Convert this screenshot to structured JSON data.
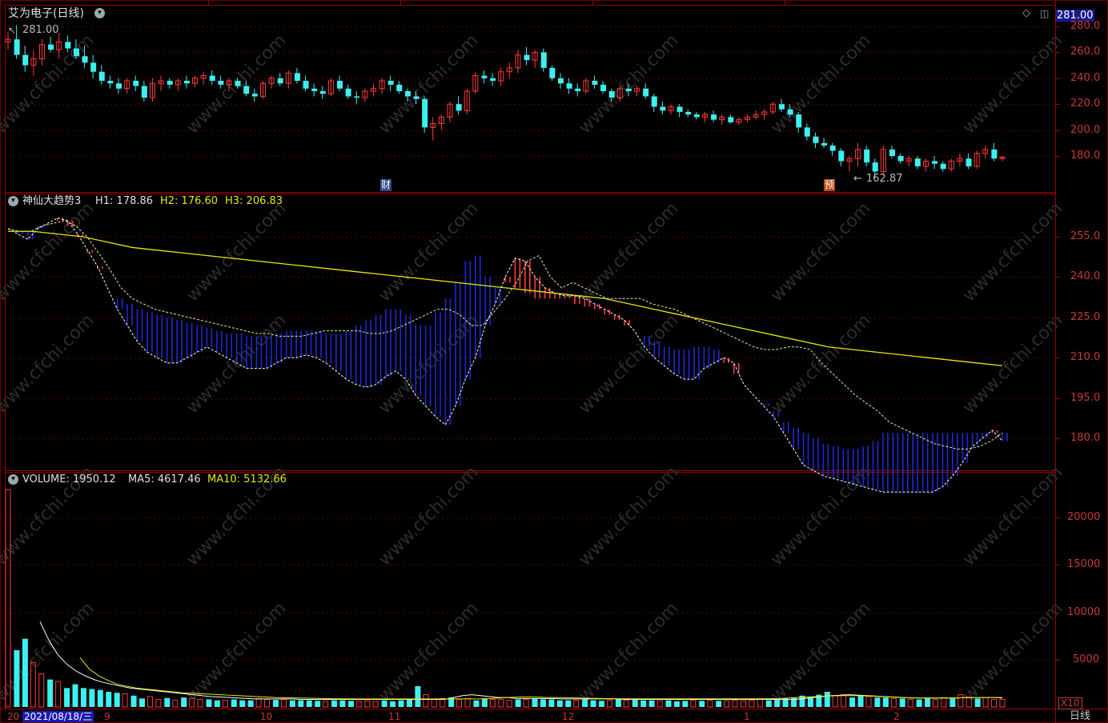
{
  "header": {
    "stock_title": "艾为电子(日线)",
    "price_marker": "281.00",
    "top_value_left": "281.00",
    "low_marker": "162.87",
    "badge_cai": "财",
    "badge_yu": "预"
  },
  "indicator_panel": {
    "name": "神仙大趋势3",
    "h1_label": "H1: 178.86",
    "h2_label": "H2: 176.60",
    "h3_label": "H3: 206.83"
  },
  "volume_panel": {
    "vol_label": "VOLUME: 1950.12",
    "ma5_label": "MA5: 4617.46",
    "ma10_label": "MA10: 5132.66",
    "unit": "X10"
  },
  "price_axis": [
    "280.0",
    "260.0",
    "240.0",
    "220.0",
    "200.0",
    "180.0"
  ],
  "indicator_axis": [
    "255.0",
    "240.0",
    "225.0",
    "210.0",
    "195.0",
    "180.0"
  ],
  "volume_axis": [
    "20000",
    "15000",
    "10000",
    "5000"
  ],
  "time_axis": {
    "cursor_date": "2021/08/18/三",
    "year_prefix": "20",
    "months": [
      "9",
      "10",
      "11",
      "12",
      "1",
      "2"
    ]
  },
  "period": "日线",
  "watermark": "www.cfchi.com",
  "colors": {
    "up": "#ff3a3a",
    "down": "#3cf0f0",
    "grid": "#6a0000",
    "axis": "#c83838",
    "yellow": "#e8e800",
    "white": "#ffffff",
    "blue_fill": "#1a2ad8"
  },
  "chart_data": {
    "type": "candlestick",
    "price": {
      "candles": [
        [
          268,
          276,
          262,
          270
        ],
        [
          270,
          281,
          255,
          258
        ],
        [
          258,
          265,
          245,
          250
        ],
        [
          250,
          262,
          242,
          255
        ],
        [
          255,
          270,
          250,
          266
        ],
        [
          266,
          272,
          260,
          262
        ],
        [
          262,
          275,
          255,
          268
        ],
        [
          268,
          273,
          260,
          263
        ],
        [
          263,
          270,
          255,
          257
        ],
        [
          257,
          265,
          248,
          252
        ],
        [
          252,
          258,
          240,
          245
        ],
        [
          245,
          250,
          235,
          238
        ],
        [
          238,
          242,
          232,
          236
        ],
        [
          236,
          240,
          228,
          232
        ],
        [
          232,
          240,
          228,
          238
        ],
        [
          238,
          242,
          230,
          234
        ],
        [
          234,
          238,
          222,
          225
        ],
        [
          225,
          240,
          222,
          236
        ],
        [
          236,
          242,
          230,
          238
        ],
        [
          238,
          240,
          232,
          235
        ],
        [
          235,
          240,
          230,
          238
        ],
        [
          238,
          242,
          232,
          236
        ],
        [
          236,
          242,
          233,
          240
        ],
        [
          240,
          245,
          235,
          242
        ],
        [
          242,
          246,
          235,
          238
        ],
        [
          238,
          242,
          232,
          235
        ],
        [
          235,
          240,
          230,
          238
        ],
        [
          238,
          240,
          232,
          234
        ],
        [
          234,
          238,
          226,
          228
        ],
        [
          228,
          232,
          222,
          226
        ],
        [
          226,
          238,
          224,
          236
        ],
        [
          236,
          242,
          232,
          240
        ],
        [
          240,
          244,
          234,
          236
        ],
        [
          236,
          246,
          232,
          244
        ],
        [
          244,
          248,
          236,
          238
        ],
        [
          238,
          242,
          230,
          232
        ],
        [
          232,
          236,
          226,
          230
        ],
        [
          230,
          234,
          224,
          228
        ],
        [
          228,
          240,
          226,
          238
        ],
        [
          238,
          242,
          230,
          232
        ],
        [
          232,
          235,
          224,
          226
        ],
        [
          226,
          230,
          220,
          225
        ],
        [
          225,
          232,
          222,
          230
        ],
        [
          230,
          236,
          226,
          232
        ],
        [
          232,
          240,
          228,
          238
        ],
        [
          238,
          242,
          230,
          235
        ],
        [
          235,
          238,
          228,
          230
        ],
        [
          230,
          232,
          222,
          226
        ],
        [
          226,
          230,
          220,
          224
        ],
        [
          224,
          226,
          198,
          202
        ],
        [
          202,
          210,
          192,
          205
        ],
        [
          205,
          212,
          200,
          210
        ],
        [
          210,
          222,
          206,
          220
        ],
        [
          220,
          226,
          212,
          215
        ],
        [
          215,
          232,
          212,
          230
        ],
        [
          230,
          245,
          228,
          242
        ],
        [
          242,
          246,
          236,
          240
        ],
        [
          240,
          244,
          234,
          238
        ],
        [
          238,
          248,
          234,
          245
        ],
        [
          245,
          252,
          240,
          248
        ],
        [
          248,
          262,
          244,
          258
        ],
        [
          258,
          264,
          250,
          254
        ],
        [
          254,
          262,
          248,
          260
        ],
        [
          260,
          263,
          245,
          248
        ],
        [
          248,
          250,
          238,
          240
        ],
        [
          240,
          244,
          232,
          236
        ],
        [
          236,
          240,
          228,
          232
        ],
        [
          232,
          236,
          226,
          230
        ],
        [
          230,
          240,
          228,
          238
        ],
        [
          238,
          242,
          232,
          235
        ],
        [
          235,
          238,
          228,
          230
        ],
        [
          230,
          232,
          222,
          225
        ],
        [
          225,
          234,
          222,
          232
        ],
        [
          232,
          236,
          226,
          230
        ],
        [
          230,
          234,
          226,
          232
        ],
        [
          232,
          236,
          224,
          226
        ],
        [
          226,
          228,
          214,
          218
        ],
        [
          218,
          222,
          212,
          215
        ],
        [
          215,
          220,
          212,
          218
        ],
        [
          218,
          220,
          210,
          214
        ],
        [
          214,
          216,
          210,
          212
        ],
        [
          212,
          214,
          208,
          210
        ],
        [
          210,
          214,
          206,
          212
        ],
        [
          212,
          215,
          206,
          208
        ],
        [
          208,
          212,
          204,
          210
        ],
        [
          210,
          212,
          205,
          206
        ],
        [
          206,
          210,
          204,
          208
        ],
        [
          208,
          212,
          206,
          210
        ],
        [
          210,
          215,
          208,
          212
        ],
        [
          212,
          216,
          208,
          214
        ],
        [
          214,
          222,
          212,
          220
        ],
        [
          220,
          224,
          214,
          216
        ],
        [
          216,
          220,
          210,
          212
        ],
        [
          212,
          214,
          198,
          202
        ],
        [
          202,
          205,
          192,
          195
        ],
        [
          195,
          198,
          186,
          190
        ],
        [
          190,
          194,
          186,
          188
        ],
        [
          188,
          190,
          180,
          184
        ],
        [
          184,
          186,
          172,
          176
        ],
        [
          176,
          180,
          168,
          178
        ],
        [
          178,
          190,
          172,
          185
        ],
        [
          185,
          188,
          172,
          175
        ],
        [
          175,
          178,
          162.87,
          168
        ],
        [
          168,
          188,
          165,
          185
        ],
        [
          185,
          188,
          178,
          180
        ],
        [
          180,
          182,
          174,
          176
        ],
        [
          176,
          180,
          172,
          178
        ],
        [
          178,
          180,
          170,
          172
        ],
        [
          172,
          178,
          168,
          176
        ],
        [
          176,
          180,
          170,
          174
        ],
        [
          174,
          176,
          168,
          170
        ],
        [
          170,
          178,
          168,
          176
        ],
        [
          176,
          182,
          172,
          178
        ],
        [
          178,
          182,
          170,
          172
        ],
        [
          172,
          184,
          170,
          182
        ],
        [
          182,
          188,
          178,
          185
        ],
        [
          185,
          190,
          176,
          178
        ],
        [
          178,
          180,
          176,
          179
        ]
      ],
      "ylim": [
        160,
        290
      ]
    },
    "indicator": {
      "lower": [
        258,
        256,
        254,
        258,
        260,
        262,
        261,
        256,
        250,
        244,
        236,
        228,
        222,
        216,
        212,
        210,
        208,
        208,
        210,
        212,
        214,
        212,
        210,
        208,
        206,
        206,
        206,
        208,
        210,
        210,
        211,
        210,
        208,
        205,
        202,
        200,
        199,
        200,
        203,
        205,
        202,
        196,
        192,
        188,
        185,
        192,
        202,
        210,
        222,
        230,
        240,
        247,
        246,
        240,
        236,
        234,
        233,
        233,
        232,
        230,
        228,
        226,
        224,
        220,
        214,
        210,
        207,
        204,
        202,
        202,
        206,
        208,
        210,
        208,
        200,
        196,
        192,
        188,
        182,
        176,
        170,
        168,
        166,
        165,
        164,
        163,
        162,
        161,
        160,
        160,
        160,
        160,
        160,
        160,
        162,
        166,
        171,
        177,
        180,
        183,
        179
      ],
      "upper": [
        258,
        257,
        257,
        259,
        260,
        261,
        259,
        255,
        249,
        243,
        236,
        232,
        230,
        228,
        227,
        226,
        225,
        224,
        223,
        222,
        221,
        220,
        219,
        219,
        218,
        218,
        218,
        219,
        220,
        220,
        220,
        220,
        219,
        219,
        220,
        222,
        224,
        226,
        228,
        228,
        226,
        222,
        222,
        227,
        232,
        238,
        246,
        248,
        240,
        236,
        238,
        236,
        234,
        232,
        232,
        232,
        232,
        230,
        229,
        228,
        226,
        224,
        222,
        220,
        218,
        216,
        214,
        213,
        213,
        214,
        214,
        213,
        208,
        204,
        200,
        196,
        193,
        190,
        186,
        184,
        182,
        180,
        178,
        177,
        176,
        176,
        177,
        179,
        182
      ],
      "yellow": [
        257,
        257,
        256,
        255,
        253,
        251,
        250,
        249,
        248,
        247,
        246,
        245,
        244,
        243,
        242,
        241,
        240,
        239,
        238,
        237,
        236,
        235,
        234,
        233,
        232,
        230,
        228,
        226,
        224,
        222,
        220,
        218,
        216,
        214,
        213,
        212,
        211,
        210,
        209,
        208,
        207
      ],
      "ylim": [
        170,
        262
      ]
    },
    "volume": {
      "values": [
        23000,
        6000,
        7200,
        4700,
        3500,
        2900,
        2700,
        2000,
        2400,
        2000,
        1900,
        1800,
        1600,
        1500,
        1400,
        1200,
        900,
        1100,
        800,
        950,
        700,
        1000,
        900,
        800,
        800,
        700,
        700,
        800,
        700,
        700,
        900,
        800,
        750,
        800,
        700,
        700,
        700,
        650,
        600,
        700,
        700,
        650,
        600,
        650,
        600,
        700,
        600,
        700,
        800,
        2200,
        1300,
        800,
        900,
        1000,
        800,
        900,
        700,
        900,
        800,
        800,
        700,
        800,
        800,
        900,
        800,
        800,
        700,
        700,
        700,
        800,
        700,
        650,
        700,
        800,
        700,
        800,
        700,
        700,
        650,
        700,
        600,
        650,
        700,
        650,
        700,
        650,
        650,
        700,
        650,
        700,
        800,
        700,
        800,
        900,
        1000,
        1200,
        1100,
        1300,
        1600,
        1200,
        1300,
        1000,
        1200,
        1100,
        1000,
        1000,
        900,
        900,
        800,
        800,
        900,
        800,
        1000,
        900,
        1300,
        1000,
        900,
        1000,
        800,
        800
      ],
      "ma5": [
        9000,
        7000,
        5500,
        4500,
        3800,
        3300,
        2900,
        2600,
        2400,
        2200,
        2000,
        1900,
        1800,
        1700,
        1600,
        1500,
        1400,
        1300,
        1200,
        1100,
        1050,
        1000,
        950,
        900,
        850,
        850,
        850,
        850,
        850,
        800,
        800,
        800,
        800,
        800,
        800,
        800,
        800,
        800,
        800,
        800,
        800,
        800,
        800,
        800,
        800,
        800,
        1000,
        1200,
        1300,
        1200,
        1100,
        1000,
        1000,
        900,
        900,
        900,
        900,
        900,
        850,
        850,
        850,
        850,
        850,
        850,
        850,
        800,
        800,
        800,
        800,
        800,
        800,
        800,
        800,
        800,
        800,
        800,
        800,
        800,
        800,
        800,
        800,
        800,
        800,
        800,
        800,
        900,
        1000,
        1100,
        1200,
        1250,
        1300,
        1250,
        1200,
        1150,
        1100,
        1050,
        1000,
        950,
        950,
        950,
        950,
        950,
        950,
        1000,
        1000,
        1000,
        1000,
        950
      ],
      "ma10": [
        5200,
        4000,
        3300,
        2800,
        2400,
        2200,
        2000,
        1900,
        1800,
        1700,
        1600,
        1500,
        1450,
        1400,
        1350,
        1300,
        1250,
        1200,
        1150,
        1100,
        1050,
        1000,
        980,
        960,
        940,
        920,
        900,
        880,
        870,
        860,
        850,
        850,
        850,
        850,
        850,
        850,
        850,
        850,
        850,
        850,
        850,
        850,
        850,
        850,
        900,
        950,
        1000,
        1050,
        1050,
        1050,
        1000,
        1000,
        980,
        960,
        940,
        920,
        900,
        890,
        880,
        870,
        860,
        860,
        860,
        860,
        860,
        860,
        860,
        860,
        860,
        860,
        860,
        860,
        860,
        870,
        880,
        900,
        950,
        1000,
        1050,
        1100,
        1150,
        1180,
        1200,
        1200,
        1180,
        1150,
        1100,
        1050,
        1000,
        980,
        960,
        950,
        950,
        950,
        960,
        980,
        1000,
        1000,
        1000,
        1000
      ],
      "ylim": [
        0,
        24000
      ]
    }
  }
}
